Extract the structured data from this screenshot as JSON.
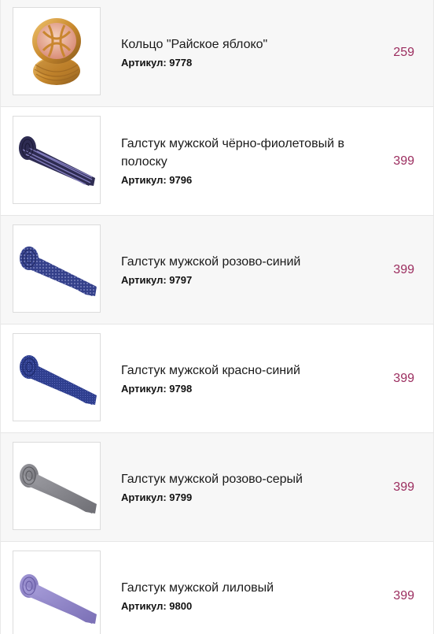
{
  "accent_color": "#9b2c5e",
  "products": [
    {
      "name": "Кольцо \"Райское яблоко\"",
      "sku": "Артикул: 9778",
      "price": "259",
      "image_icon": "ring-icon"
    },
    {
      "name": "Галстук мужской чёрно-фиолетовый в полоску",
      "sku": "Артикул: 9796",
      "price": "399",
      "image_icon": "tie-icon",
      "tie_color": "#2e2c52"
    },
    {
      "name": "Галстук мужской розово-синий",
      "sku": "Артикул: 9797",
      "price": "399",
      "image_icon": "tie-icon",
      "tie_color": "#34408a"
    },
    {
      "name": "Галстук мужской красно-синий",
      "sku": "Артикул: 9798",
      "price": "399",
      "image_icon": "tie-icon",
      "tie_color": "#2f3f8f"
    },
    {
      "name": "Галстук мужской розово-серый",
      "sku": "Артикул: 9799",
      "price": "399",
      "image_icon": "tie-icon",
      "tie_color": "#838388"
    },
    {
      "name": "Галстук мужской лиловый",
      "sku": "Артикул: 9800",
      "price": "399",
      "image_icon": "tie-icon",
      "tie_color": "#8a7fc2"
    }
  ]
}
